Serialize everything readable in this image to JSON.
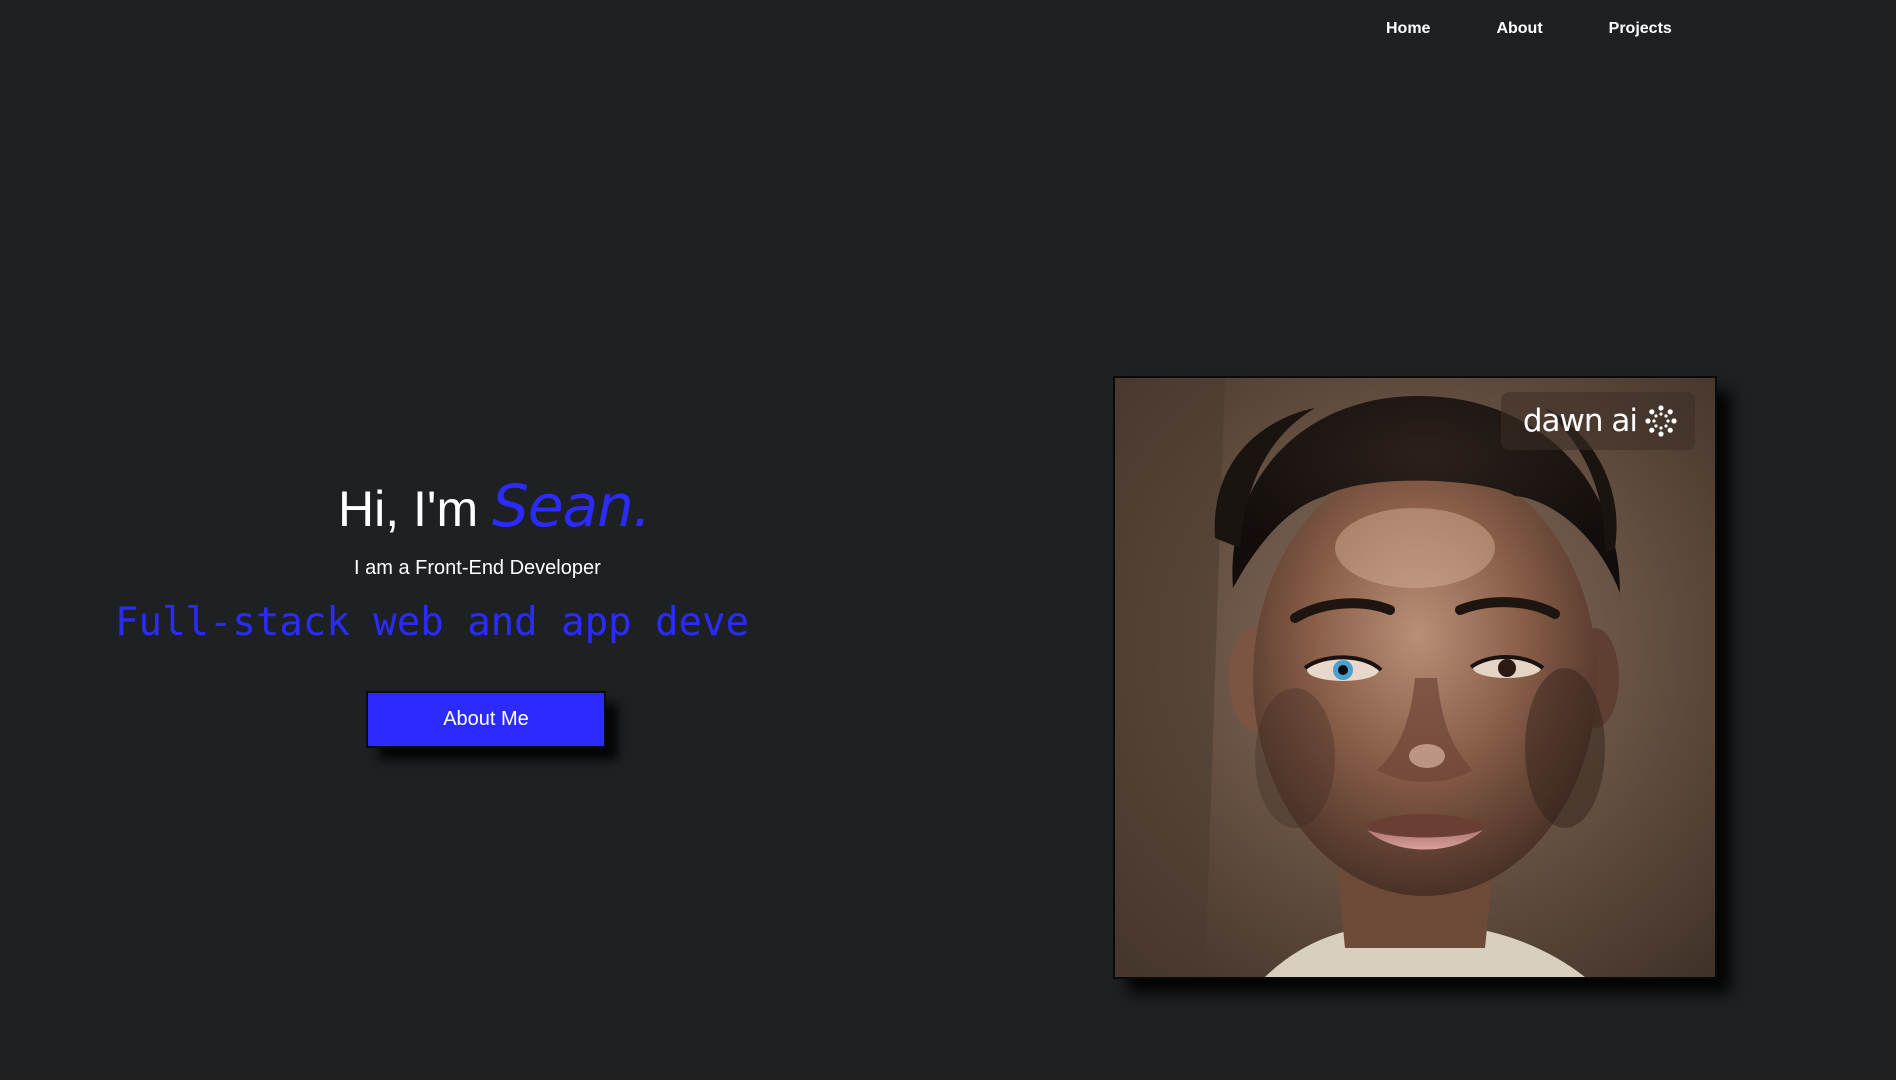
{
  "nav": {
    "home": "Home",
    "about": "About",
    "projects": "Projects"
  },
  "hero": {
    "greeting": "Hi, I'm",
    "name": "Sean.",
    "subtitle": "I am a Front-End Developer",
    "typing_text": "Full-stack web and app deve",
    "button_label": "About Me"
  },
  "portrait": {
    "watermark_text": "dawn ai",
    "watermark_icon": "dawn-ai-logo-icon"
  },
  "colors": {
    "background": "#1e2124",
    "accent": "#2b2bff",
    "text": "#ffffff"
  }
}
